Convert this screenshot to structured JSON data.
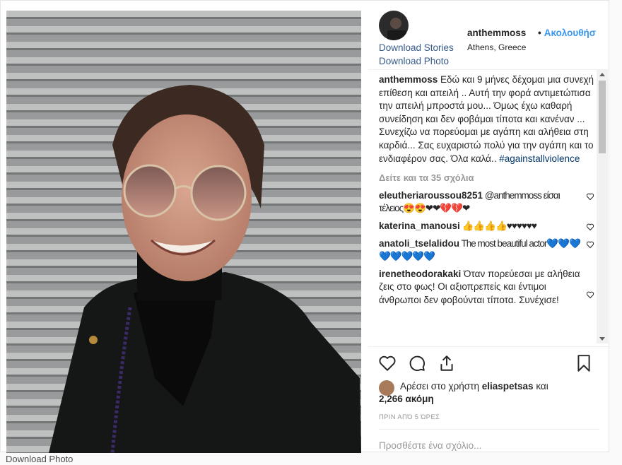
{
  "post": {
    "username": "anthemmoss",
    "follow": "Ακολουθήσ",
    "location": "Athens, Greece",
    "download_stories": "Download Stories",
    "download_photo": "Download Photo",
    "caption_text": " Εδώ και 9 μήνες δέχομαι μια συνεχή επίθεση και απειλή .. Αυτή την φορά αντιμετώπισα την απειλή μπροστά μου... Όμως έχω καθαρή συνείδηση και δεν φοβάμαι τίποτα και κανέναν ... Συνεχίζω να πορεύομαι με αγάπη και αλήθεια στη καρδιά... Σας ευχαριστώ πολύ για την αγάπη και το ενδιαφέρον σας. Όλα καλά.. ",
    "caption_tag": "#againstallviolence",
    "view_all": "Δείτε και τα 35 σχόλια",
    "likes_text": "Αρέσει στο χρήστη",
    "likes_user": "eliaspetsas",
    "likes_and": "και",
    "likes_more": "2,266 ακόμη",
    "timestamp": "ΠΡΙΝ ΑΠΌ 5 ΏΡΕΣ",
    "add_comment": "Προσθέστε ένα σχόλιο..."
  },
  "comments": [
    {
      "user": "eleutheriaroussou8251",
      "text": " @anthemmoss είσαι τέλειος😍😍❤❤💔💔❤"
    },
    {
      "user": "katerina_manousi",
      "text": " 👍👍👍👍♥♥♥♥♥♥"
    },
    {
      "user": "anatoli_tselalidou",
      "text": " The most beautiful actor💙💙💙💙💙💙💙💙"
    },
    {
      "user": "irenetheodorakaki",
      "text": " Όταν πορεύεσαι με αλήθεια ζεις στο φως! Οι αξιοπρεπείς και έντιμοι άνθρωποι δεν φοβούνται τίποτα. Συνέχισε!"
    }
  ],
  "footer": {
    "download_photo": "Download Photo"
  },
  "colors": {
    "link": "#385b8a",
    "follow": "#3897f0",
    "muted": "#999999"
  },
  "icons": [
    "heart-icon",
    "comment-icon",
    "share-icon",
    "bookmark-icon"
  ]
}
